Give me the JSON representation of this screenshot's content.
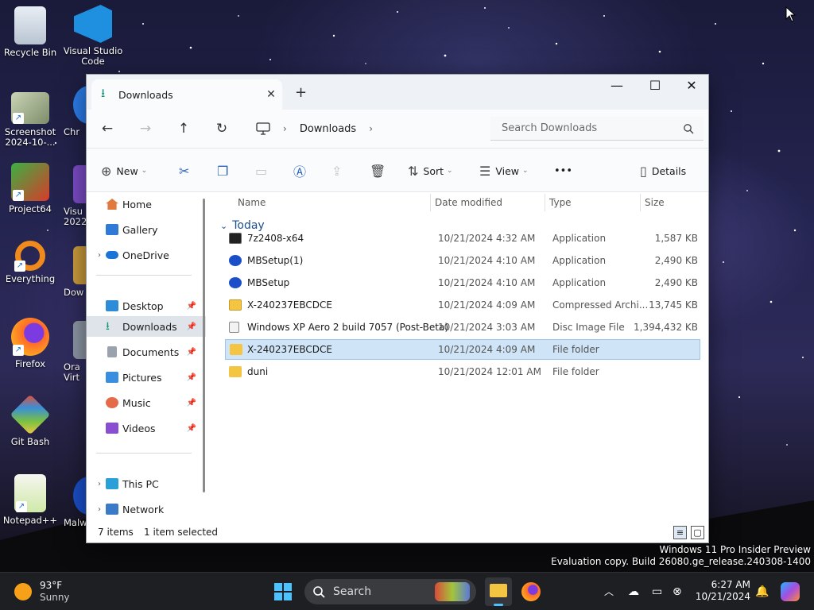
{
  "desktop": {
    "icons": [
      {
        "label": "Recycle Bin"
      },
      {
        "label": "Visual Studio Code"
      },
      {
        "label": "Screenshot 2024-10-..."
      },
      {
        "label": "Chr"
      },
      {
        "label": "Project64"
      },
      {
        "label": "Visu 2022"
      },
      {
        "label": "Everything"
      },
      {
        "label": "Dow"
      },
      {
        "label": "Firefox"
      },
      {
        "label": "Ora Virt"
      },
      {
        "label": "Git Bash"
      },
      {
        "label": "Notepad++"
      },
      {
        "label": "Malw"
      }
    ],
    "watermark": {
      "line1": "Windows 11 Pro Insider Preview",
      "line2": "Evaluation copy. Build 26080.ge_release.240308-1400"
    }
  },
  "explorer": {
    "tab_title": "Downloads",
    "window_controls": {
      "minimize": "—",
      "maximize": "☐",
      "close": "✕"
    },
    "nav": {
      "back": "←",
      "forward": "→",
      "up": "↑",
      "refresh": "↻"
    },
    "address": {
      "location": "Downloads",
      "separator": "›"
    },
    "search_placeholder": "Search Downloads",
    "toolbar": {
      "new_label": "New",
      "sort_label": "Sort",
      "view_label": "View",
      "more_label": "•••",
      "details_label": "Details"
    },
    "sidebar": {
      "home": "Home",
      "gallery": "Gallery",
      "onedrive": "OneDrive",
      "desktop": "Desktop",
      "downloads": "Downloads",
      "documents": "Documents",
      "pictures": "Pictures",
      "music": "Music",
      "videos": "Videos",
      "thispc": "This PC",
      "network": "Network"
    },
    "columns": {
      "name": "Name",
      "date": "Date modified",
      "type": "Type",
      "size": "Size"
    },
    "group_label": "Today",
    "files": [
      {
        "name": "7z2408-x64",
        "date": "10/21/2024 4:32 AM",
        "type": "Application",
        "size": "1,587 KB",
        "icon": "sevenzip-icon"
      },
      {
        "name": "MBSetup(1)",
        "date": "10/21/2024 4:10 AM",
        "type": "Application",
        "size": "2,490 KB",
        "icon": "mbsetup-icon"
      },
      {
        "name": "MBSetup",
        "date": "10/21/2024 4:10 AM",
        "type": "Application",
        "size": "2,490 KB",
        "icon": "mbsetup-icon"
      },
      {
        "name": "X-240237EBCDCE",
        "date": "10/21/2024 4:09 AM",
        "type": "Compressed Archi...",
        "size": "13,745 KB",
        "icon": "zip-folder-icon"
      },
      {
        "name": "Windows XP Aero 2 build 7057 (Post-Beta)",
        "date": "10/21/2024 3:03 AM",
        "type": "Disc Image File",
        "size": "1,394,432 KB",
        "icon": "disc-image-icon"
      },
      {
        "name": "X-240237EBCDCE",
        "date": "10/21/2024 4:09 AM",
        "type": "File folder",
        "size": "",
        "icon": "folder-icon"
      },
      {
        "name": "duni",
        "date": "10/21/2024 12:01 AM",
        "type": "File folder",
        "size": "",
        "icon": "folder-icon"
      }
    ],
    "status": {
      "items": "7 items",
      "selected": "1 item selected"
    }
  },
  "taskbar": {
    "weather_temp": "93°F",
    "weather_desc": "Sunny",
    "search_label": "Search",
    "time": "6:27 AM",
    "date": "10/21/2024"
  },
  "colors": {
    "accent": "#1c6ed4",
    "selection": "#cfe4f7",
    "folder": "#f4c542",
    "taskbar": "#1e1f22"
  }
}
